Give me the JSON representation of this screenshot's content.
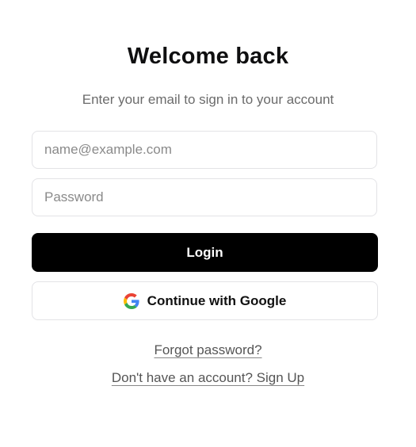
{
  "header": {
    "title": "Welcome back",
    "subtitle": "Enter your email to sign in to your account"
  },
  "form": {
    "email": {
      "value": "",
      "placeholder": "name@example.com"
    },
    "password": {
      "value": "",
      "placeholder": "Password"
    },
    "login_label": "Login",
    "google_label": "Continue with Google"
  },
  "links": {
    "forgot_password": "Forgot password?",
    "signup": "Don't have an account? Sign Up"
  },
  "colors": {
    "primary_button_bg": "#000000",
    "primary_button_text": "#ffffff",
    "border": "#e3e3e6",
    "muted_text": "#6b6b6b"
  },
  "icons": {
    "google": "google-logo-icon"
  }
}
